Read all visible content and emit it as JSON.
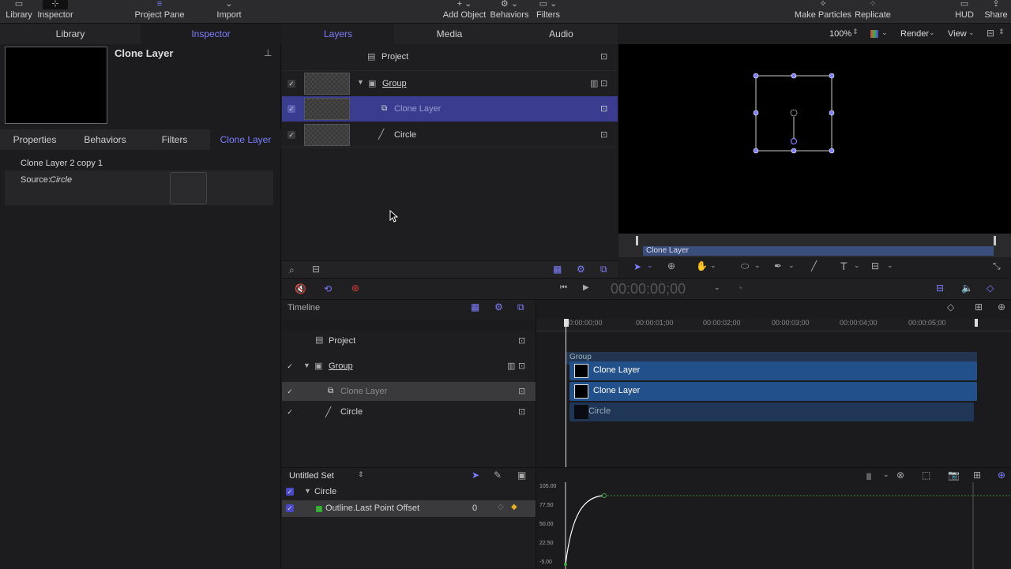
{
  "toolbar": {
    "library": "Library",
    "inspector": "Inspector",
    "project_pane": "Project Pane",
    "import": "Import",
    "add_object": "Add Object",
    "behaviors": "Behaviors",
    "filters": "Filters",
    "make_particles": "Make Particles",
    "replicate": "Replicate",
    "hud": "HUD",
    "share": "Share"
  },
  "left_tabs": {
    "library": "Library",
    "inspector": "Inspector"
  },
  "inspector": {
    "title": "Clone Layer",
    "subtabs": [
      "Properties",
      "Behaviors",
      "Filters",
      "Clone Layer"
    ],
    "section_title": "Clone Layer 2 copy 1",
    "source_label": "Source:",
    "source_value": "Circle"
  },
  "layers_tabs": {
    "layers": "Layers",
    "media": "Media",
    "audio": "Audio"
  },
  "layers": [
    {
      "name": "Project"
    },
    {
      "name": "Group"
    },
    {
      "name": "Clone Layer"
    },
    {
      "name": "Circle"
    }
  ],
  "canvas": {
    "zoom": "100%",
    "render": "Render",
    "view": "View",
    "mini_timeline_label": "Clone Layer"
  },
  "transport": {
    "timecode": "00:00:00;00"
  },
  "timeline": {
    "title": "Timeline",
    "ruler": [
      "00:00:00;00",
      "00:00:01;00",
      "00:00:02;00",
      "00:00:03;00",
      "00:00:04;00",
      "00:00:05;00"
    ],
    "layers": [
      "Project",
      "Group",
      "Clone Layer",
      "Circle"
    ],
    "group_label": "Group",
    "bars": [
      "Clone Layer",
      "Clone Layer",
      "Circle"
    ]
  },
  "keyframe": {
    "set_name": "Untitled Set",
    "group": "Circle",
    "param": "Outline.Last Point Offset",
    "value": "0",
    "y_ticks": [
      "105.00",
      "77.50",
      "50.00",
      "22.50",
      "-5.00"
    ]
  },
  "colors": {
    "accent": "#7d7dff",
    "selection": "#3a3d8f",
    "bar": "#22508a"
  }
}
